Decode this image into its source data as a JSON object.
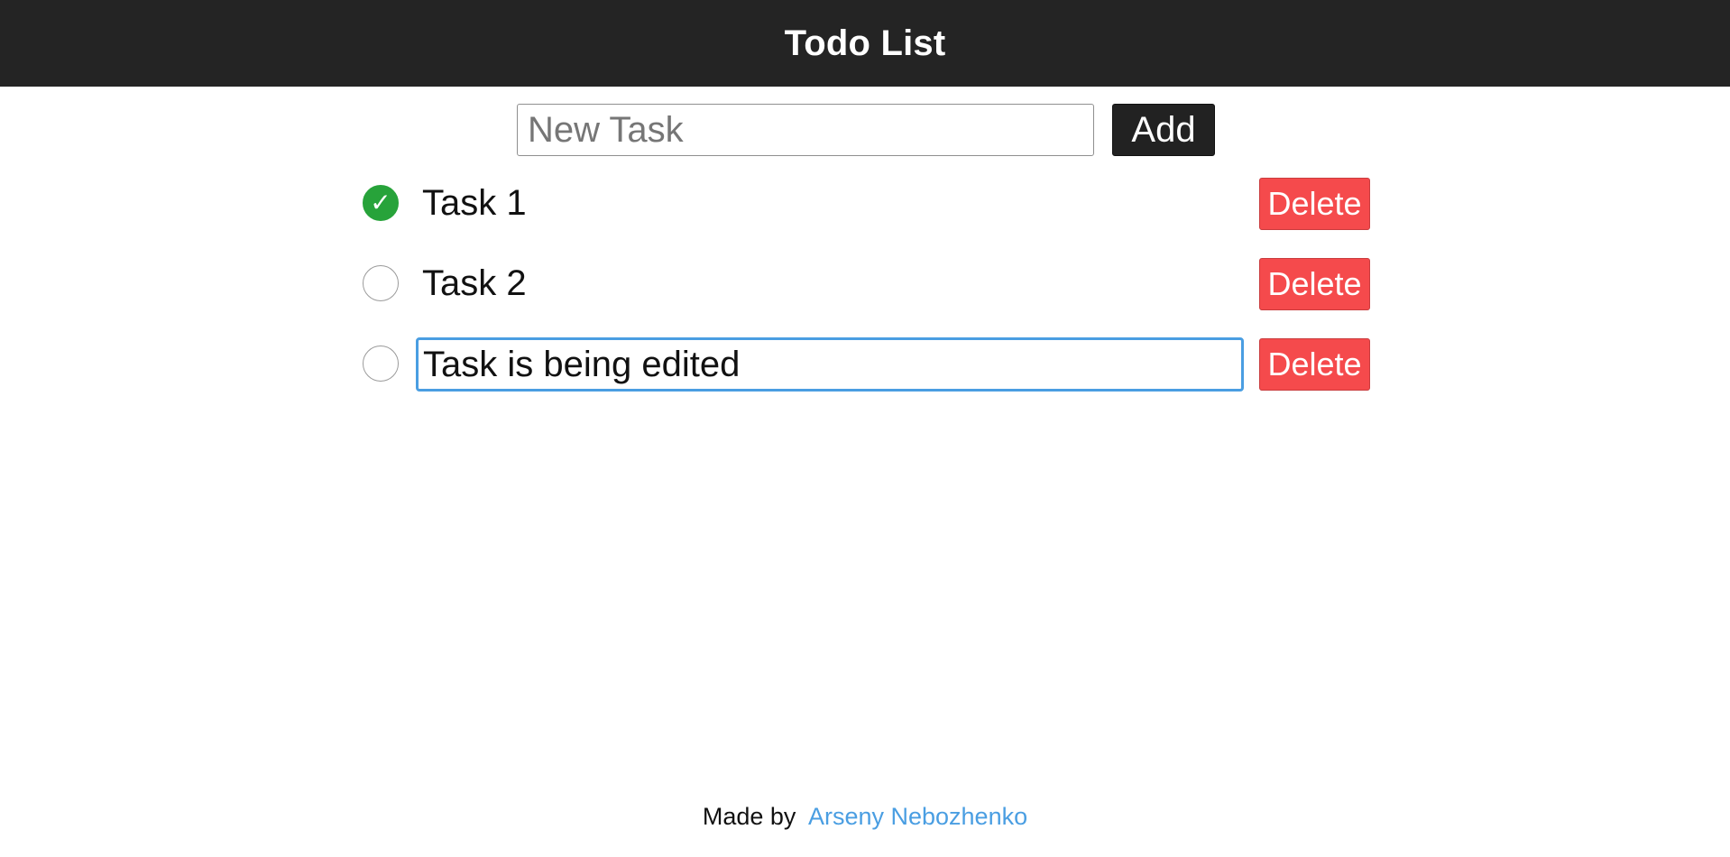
{
  "header": {
    "title": "Todo List"
  },
  "new_task": {
    "value": "",
    "placeholder": "New Task",
    "add_label": "Add"
  },
  "tasks": [
    {
      "text": "Task 1",
      "completed": true,
      "editing": false,
      "delete_label": "Delete"
    },
    {
      "text": "Task 2",
      "completed": false,
      "editing": false,
      "delete_label": "Delete"
    },
    {
      "text": "Task is being edited",
      "completed": false,
      "editing": true,
      "delete_label": "Delete"
    }
  ],
  "check_icon": "✓",
  "footer": {
    "prefix": "Made by",
    "author": "Arseny Nebozhenko"
  },
  "colors": {
    "header_bg": "#242424",
    "completed_green": "#27a33a",
    "delete_red": "#f54a4c",
    "link_blue": "#4a9ee2",
    "focus_blue": "#4a9ee2"
  }
}
